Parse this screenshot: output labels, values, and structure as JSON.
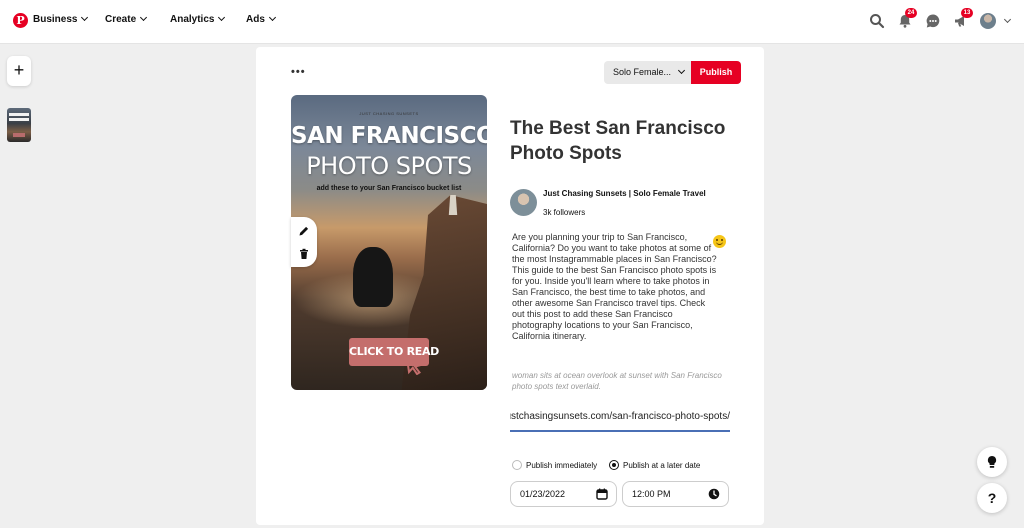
{
  "nav": {
    "logo": "P",
    "items": [
      {
        "label": "Business"
      },
      {
        "label": "Create"
      },
      {
        "label": "Analytics"
      },
      {
        "label": "Ads"
      }
    ],
    "notifications_count": "24",
    "updates_count": "13",
    "brand_color": "#e60023"
  },
  "sidebar": {
    "create_label": "+"
  },
  "toolbar": {
    "more_label": "•••",
    "board_value": "Solo Female...",
    "publish_label": "Publish"
  },
  "pin_image": {
    "cap_text": "JUST CHASING SUNSETS",
    "headline_1": "SAN FRANCISCO",
    "headline_2": "PHOTO SPOTS",
    "subline": "add these to your San Francisco bucket list",
    "cta": "CLICK TO READ"
  },
  "pin": {
    "title": "The Best San Francisco Photo Spots",
    "author_name": "Just Chasing Sunsets | Solo Female Travel",
    "author_followers": "3k followers",
    "description": "Are you planning your trip to San Francisco, California? Do you want to take photos at some of the most Instagrammable places in San Francisco? This guide to the best San Francisco photo spots is for you. Inside you'll learn where to take photos in San Francisco, the best time to take photos, and other awesome San Francisco travel tips. Check out this post to add these San Francisco photography locations to your San Francisco, California itinerary.",
    "alt_text": "woman sits at ocean overlook at sunset with San Francisco photo spots text overlaid.",
    "link": "https://justchasingsunsets.com/san-francisco-photo-spots/"
  },
  "schedule": {
    "option_now": "Publish immediately",
    "option_later": "Publish at a later date",
    "selected": "later",
    "date": "01/23/2022",
    "time": "12:00 PM"
  },
  "help": {
    "question_label": "?"
  }
}
